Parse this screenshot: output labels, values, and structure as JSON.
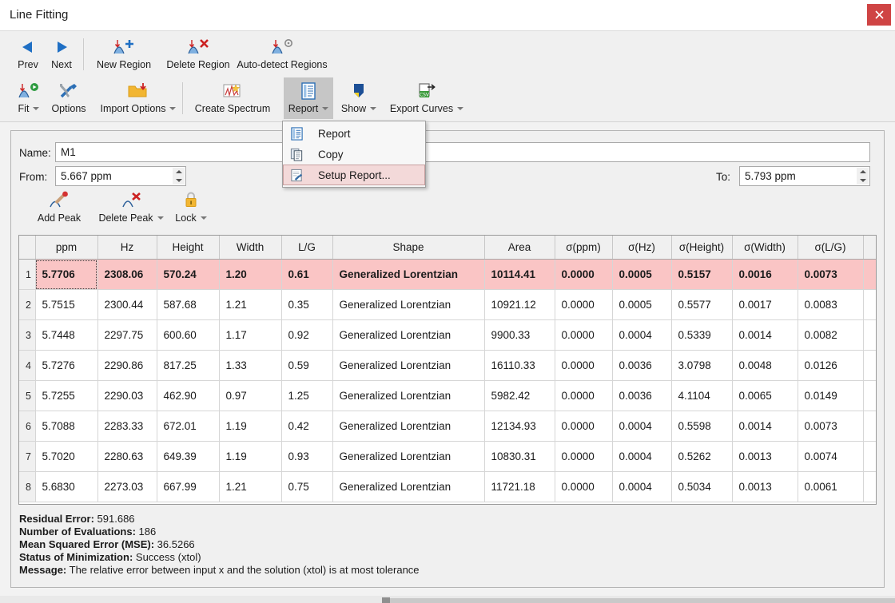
{
  "window": {
    "title": "Line Fitting",
    "close_label": "✕",
    "close_color": "#cf4444"
  },
  "ribbon": {
    "row1": [
      {
        "label": "Prev",
        "icon": "arrow-left-icon"
      },
      {
        "label": "Next",
        "icon": "arrow-right-icon"
      },
      {
        "label": "New Region",
        "icon": "new-region-icon"
      },
      {
        "label": "Delete Region",
        "icon": "delete-region-icon"
      },
      {
        "label": "Auto-detect Regions",
        "icon": "auto-detect-regions-icon"
      }
    ],
    "row2": [
      {
        "label": "Fit",
        "icon": "fit-icon",
        "caret": true
      },
      {
        "label": "Options",
        "icon": "options-icon",
        "caret": false
      },
      {
        "label": "Import Options",
        "icon": "import-options-icon",
        "caret": true
      },
      {
        "label": "Create Spectrum",
        "icon": "create-spectrum-icon",
        "caret": false
      },
      {
        "label": "Report",
        "icon": "report-icon",
        "caret": true,
        "active": true
      },
      {
        "label": "Show",
        "icon": "show-icon",
        "caret": true
      },
      {
        "label": "Export Curves",
        "icon": "export-curves-icon",
        "caret": true
      }
    ]
  },
  "report_menu": {
    "items": [
      {
        "label": "Report",
        "icon": "report-doc-icon",
        "selected": false
      },
      {
        "label": "Copy",
        "icon": "copy-icon",
        "selected": false
      },
      {
        "label": "Setup Report...",
        "icon": "setup-report-icon",
        "selected": true
      }
    ],
    "highlight_color": "#f3d9d9"
  },
  "form": {
    "name_label": "Name:",
    "name_value": "M1",
    "name_placeholder": "",
    "from_label": "From:",
    "from_value": "5.667 ppm",
    "to_label": "To:",
    "to_value": "5.793 ppm"
  },
  "peak_toolbar": [
    {
      "label": "Add Peak",
      "icon": "add-peak-icon",
      "caret": false
    },
    {
      "label": "Delete Peak",
      "icon": "delete-peak-icon",
      "caret": true
    },
    {
      "label": "Lock",
      "icon": "lock-icon",
      "caret": true
    }
  ],
  "table": {
    "columns": [
      "ppm",
      "Hz",
      "Height",
      "Width",
      "L/G",
      "Shape",
      "Area",
      "σ(ppm)",
      "σ(Hz)",
      "σ(Height)",
      "σ(Width)",
      "σ(L/G)"
    ],
    "selected_row_index": 0,
    "selected_row_color": "#fac5c5",
    "rows": [
      {
        "n": "1",
        "cells": [
          "5.7706",
          "2308.06",
          "570.24",
          "1.20",
          "0.61",
          "Generalized Lorentzian",
          "10114.41",
          "0.0000",
          "0.0005",
          "0.5157",
          "0.0016",
          "0.0073"
        ]
      },
      {
        "n": "2",
        "cells": [
          "5.7515",
          "2300.44",
          "587.68",
          "1.21",
          "0.35",
          "Generalized Lorentzian",
          "10921.12",
          "0.0000",
          "0.0005",
          "0.5577",
          "0.0017",
          "0.0083"
        ]
      },
      {
        "n": "3",
        "cells": [
          "5.7448",
          "2297.75",
          "600.60",
          "1.17",
          "0.92",
          "Generalized Lorentzian",
          "9900.33",
          "0.0000",
          "0.0004",
          "0.5339",
          "0.0014",
          "0.0082"
        ]
      },
      {
        "n": "4",
        "cells": [
          "5.7276",
          "2290.86",
          "817.25",
          "1.33",
          "0.59",
          "Generalized Lorentzian",
          "16110.33",
          "0.0000",
          "0.0036",
          "3.0798",
          "0.0048",
          "0.0126"
        ]
      },
      {
        "n": "5",
        "cells": [
          "5.7255",
          "2290.03",
          "462.90",
          "0.97",
          "1.25",
          "Generalized Lorentzian",
          "5982.42",
          "0.0000",
          "0.0036",
          "4.1104",
          "0.0065",
          "0.0149"
        ]
      },
      {
        "n": "6",
        "cells": [
          "5.7088",
          "2283.33",
          "672.01",
          "1.19",
          "0.42",
          "Generalized Lorentzian",
          "12134.93",
          "0.0000",
          "0.0004",
          "0.5598",
          "0.0014",
          "0.0073"
        ]
      },
      {
        "n": "7",
        "cells": [
          "5.7020",
          "2280.63",
          "649.39",
          "1.19",
          "0.93",
          "Generalized Lorentzian",
          "10830.31",
          "0.0000",
          "0.0004",
          "0.5262",
          "0.0013",
          "0.0074"
        ]
      },
      {
        "n": "8",
        "cells": [
          "5.6830",
          "2273.03",
          "667.99",
          "1.21",
          "0.75",
          "Generalized Lorentzian",
          "11721.18",
          "0.0000",
          "0.0004",
          "0.5034",
          "0.0013",
          "0.0061"
        ]
      }
    ]
  },
  "stats": [
    {
      "label": "Residual Error:",
      "value": "591.686"
    },
    {
      "label": "Number of Evaluations:",
      "value": "186"
    },
    {
      "label": "Mean Squared Error (MSE):",
      "value": "36.5266"
    },
    {
      "label": "Status of Minimization:",
      "value": "Success (xtol)"
    },
    {
      "label": "Message:",
      "value": "The relative error between input x and the solution (xtol) is at most tolerance"
    }
  ]
}
